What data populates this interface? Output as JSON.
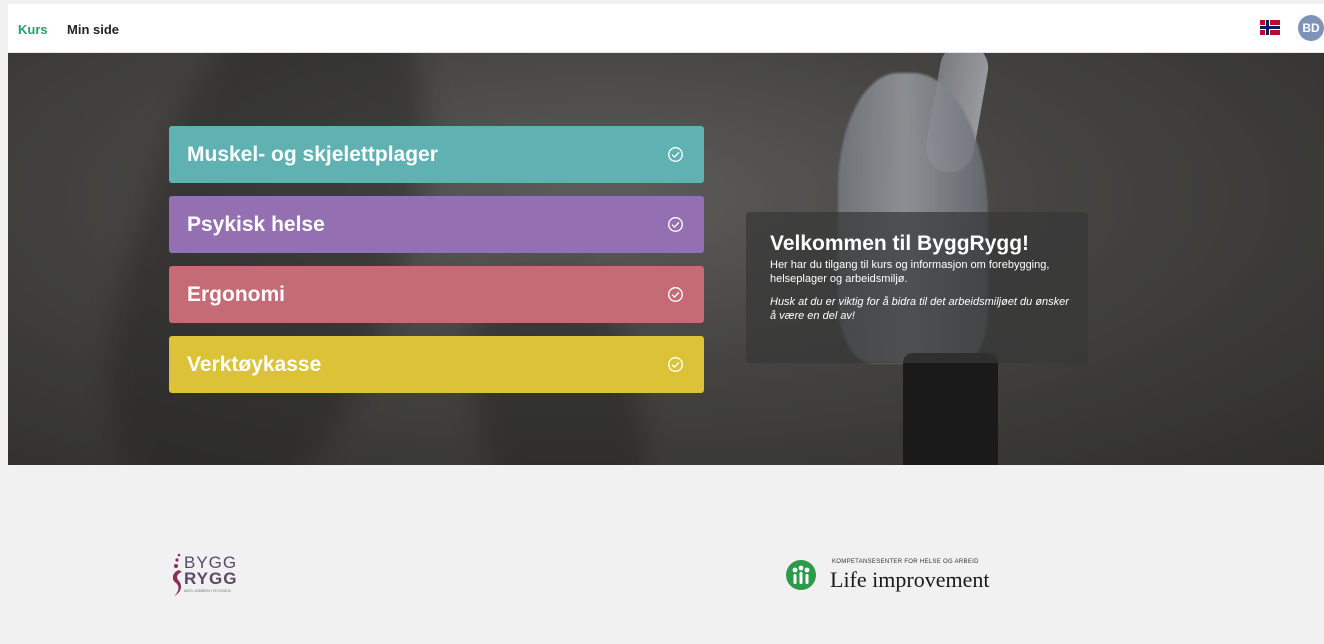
{
  "nav": {
    "items": [
      {
        "label": "Kurs",
        "active": true
      },
      {
        "label": "Min side",
        "active": false
      }
    ],
    "language_flag": "norway-flag-icon",
    "avatar_initials": "BD"
  },
  "courses": [
    {
      "label": "Muskel- og skjelettplager",
      "color": "#5fb1b2",
      "icon": "check-circle-icon"
    },
    {
      "label": "Psykisk helse",
      "color": "#9470b2",
      "icon": "check-circle-icon"
    },
    {
      "label": "Ergonomi",
      "color": "#c56b76",
      "icon": "check-circle-icon"
    },
    {
      "label": "Verktøykasse",
      "color": "#dcc236",
      "icon": "check-circle-icon"
    }
  ],
  "welcome": {
    "title": "Velkommen til ByggRygg!",
    "text": "Her har du tilgang til kurs og informasjon om forebygging, helseplager og arbeidsmiljø.",
    "italic_text": "Husk at du er viktig for å bidra til det arbeidsmiljøet du ønsker å være en del av!"
  },
  "footer": {
    "bygg_logo": {
      "line1": "BYGG",
      "line2": "RYGG",
      "tagline": "MED JOBBEN I RYGGEN"
    },
    "life_logo": {
      "small": "KOMPETANSESENTER FOR HELSE OG ARBEID",
      "big": "Life improvement",
      "color": "#2b9b4a"
    }
  }
}
